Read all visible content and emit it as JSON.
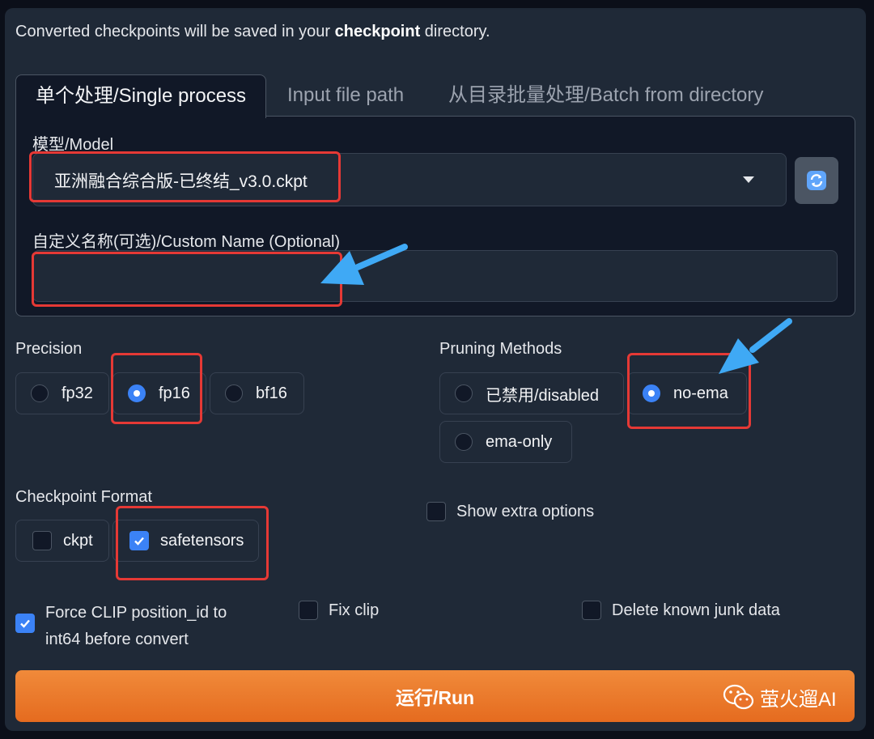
{
  "info": {
    "prefix": "Converted checkpoints will be saved in your ",
    "bold": "checkpoint",
    "suffix": " directory."
  },
  "tabs": [
    {
      "label": "单个处理/Single process",
      "active": true
    },
    {
      "label": "Input file path",
      "active": false
    },
    {
      "label": "从目录批量处理/Batch from directory",
      "active": false
    }
  ],
  "model": {
    "label": "模型/Model",
    "value": "亚洲融合综合版-已终结_v3.0.ckpt"
  },
  "custom_name": {
    "label": "自定义名称(可选)/Custom Name (Optional)",
    "value": ""
  },
  "precision": {
    "label": "Precision",
    "options": [
      "fp32",
      "fp16",
      "bf16"
    ],
    "selected": "fp16"
  },
  "pruning": {
    "label": "Pruning Methods",
    "options": [
      "已禁用/disabled",
      "no-ema",
      "ema-only"
    ],
    "selected": "no-ema"
  },
  "format": {
    "label": "Checkpoint Format",
    "options": [
      {
        "label": "ckpt",
        "checked": false
      },
      {
        "label": "safetensors",
        "checked": true
      }
    ]
  },
  "extra_options": {
    "label": "Show extra options",
    "checked": false
  },
  "force_clip": {
    "label_line1": "Force CLIP position_id to",
    "label_line2": "int64 before convert",
    "checked": true
  },
  "fix_clip": {
    "label": "Fix clip",
    "checked": false
  },
  "delete_junk": {
    "label": "Delete known junk data",
    "checked": false
  },
  "run_button": "运行/Run",
  "watermark": "萤火遛AI",
  "colors": {
    "accent": "#3b82f6",
    "run_button": "#ea7326",
    "annotation_box": "#e53935",
    "annotation_arrow": "#3fa9f5"
  }
}
